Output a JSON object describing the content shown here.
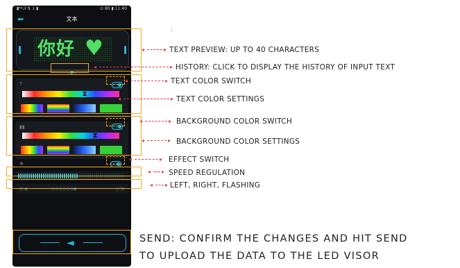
{
  "status_bar": {
    "left": "▮⁴ᵍ.ıl ⇅ 1 ▮",
    "right": "⊙ 80 ▮ 11:40"
  },
  "header": {
    "back_icon": "arrow-left-icon",
    "title": "文本"
  },
  "preview": {
    "led_text": "你好",
    "led_heart": "♥"
  },
  "history": {
    "icon": "chevron-double-down-icon",
    "label": "≈▼≈"
  },
  "text_color": {
    "icon": "text-color-icon",
    "swatches": [
      "rainbow-vertical",
      "rainbow-horizontal",
      "blue-gradient",
      "green"
    ]
  },
  "background_color": {
    "icon": "background-color-icon",
    "swatches": [
      "rainbow-stripes",
      "rainbow-horizontal",
      "blue-gradient",
      "green"
    ]
  },
  "effect": {
    "icon": "effect-icon"
  },
  "speed": {
    "value": 0.55
  },
  "direction": {
    "left": "⊏◀",
    "middle": "◁◁◁◁◁◁◀",
    "right": "▷⊐"
  },
  "send": {
    "icon": "send-icon",
    "glyph": "◄"
  },
  "annotations": {
    "text_preview": "TEXT PREVIEW: UP TO 40 CHARACTERS",
    "history": "HISTORY: CLICK TO DISPLAY THE HISTORY OF INPUT TEXT",
    "text_color_switch": "TEXT COLOR SWITCH",
    "text_color_settings": "TEXT COLOR SETTINGS",
    "bg_color_switch": "BACKGROUND COLOR SWITCH",
    "bg_color_settings": "BACKGROUND COLOR SETTINGS",
    "effect_switch": "EFFECT SWITCH",
    "speed_regulation": "SPEED REGULATION",
    "direction": "LEFT, RIGHT, FLASHING",
    "send_line1": "SEND: CONFIRM THE CHANGES AND HIT SEND",
    "send_line2": "TO UPLOAD THE DATA TO THE LED VISOR",
    "stray_mark": ";"
  },
  "colors": {
    "accent": "#2fb3d8",
    "highlight": "#f4a81f",
    "arrow": "#e63946",
    "led": "#52df66"
  }
}
